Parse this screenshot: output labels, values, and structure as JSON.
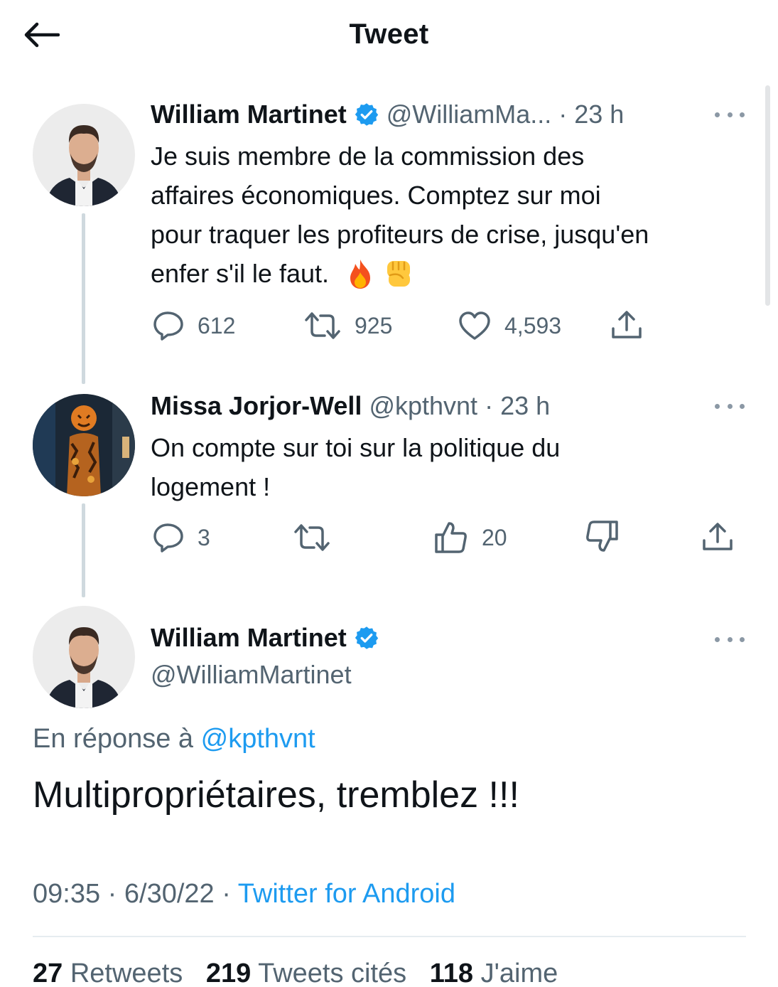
{
  "header": {
    "title": "Tweet"
  },
  "tweets": [
    {
      "name": "William Martinet",
      "handle": "@WilliamMa...",
      "time": "23 h",
      "text_lines": [
        "Je suis membre de la commission des",
        "affaires économiques. Comptez sur moi",
        "pour traquer les profiteurs de crise, jusqu'en",
        "enfer s'il le faut."
      ],
      "emojis": [
        "fire-emoji",
        "raised-fist-emoji"
      ],
      "replies": "612",
      "retweets": "925",
      "likes": "4,593"
    },
    {
      "name": "Missa Jorjor-Well",
      "handle": "@kpthvnt",
      "time": "23 h",
      "text_lines": [
        "On compte sur toi sur la politique du",
        "logement !"
      ],
      "replies": "3",
      "upvotes": "20"
    }
  ],
  "main_tweet": {
    "name": "William Martinet",
    "handle": "@WilliamMartinet",
    "reply_prefix": "En réponse à",
    "reply_to": "@kpthvnt",
    "text": "Multipropriétaires, tremblez !!!",
    "time": "09:35",
    "date": "6/30/22",
    "source": "Twitter for Android",
    "stats": [
      {
        "count": "27",
        "label": "Retweets"
      },
      {
        "count": "219",
        "label": "Tweets cités"
      },
      {
        "count": "118",
        "label": "J'aime"
      }
    ]
  },
  "colors": {
    "accent": "#1d9bf0",
    "secondary_text": "#536471",
    "line": "#cfd9de"
  }
}
